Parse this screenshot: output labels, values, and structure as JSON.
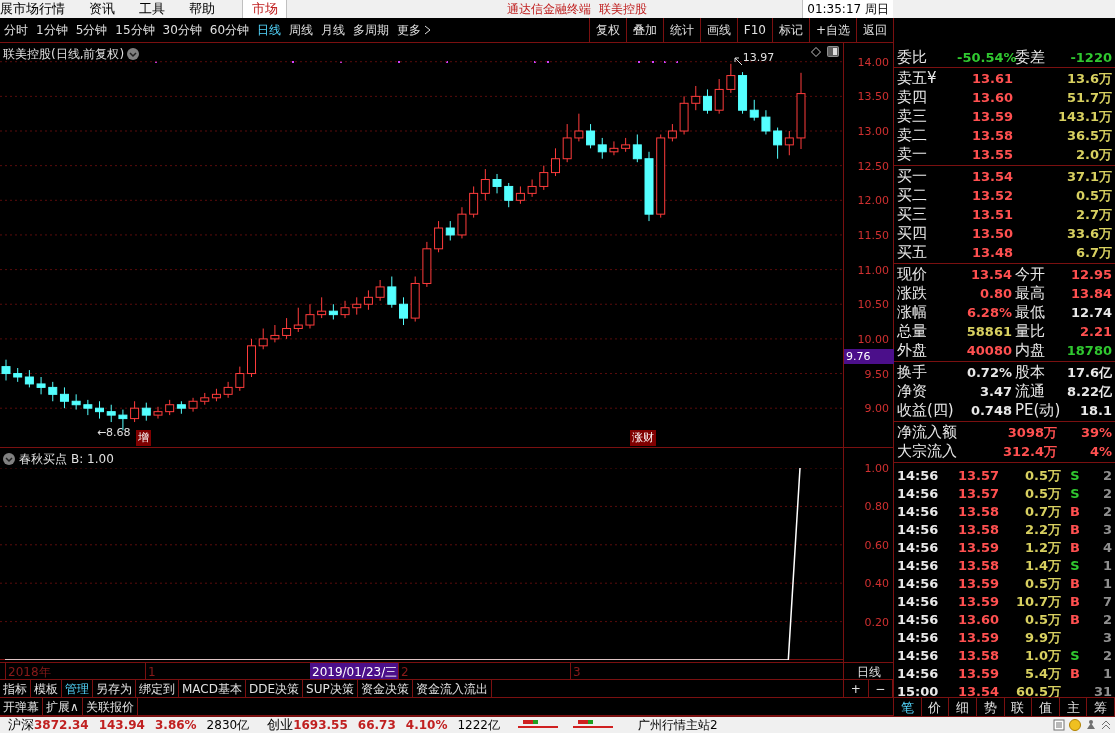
{
  "menu_bar": {
    "items": [
      "展市场行情",
      "资讯",
      "工具",
      "帮助"
    ],
    "market_tab": "市场",
    "app_title": "通达信金融终端",
    "stock_title": "联美控股",
    "clock": "01:35:17 周日"
  },
  "toolbar": {
    "periods": [
      {
        "label": "分时",
        "selected": false
      },
      {
        "label": "1分钟",
        "selected": false
      },
      {
        "label": "5分钟",
        "selected": false
      },
      {
        "label": "15分钟",
        "selected": false
      },
      {
        "label": "30分钟",
        "selected": false
      },
      {
        "label": "60分钟",
        "selected": false
      },
      {
        "label": "日线",
        "selected": true
      },
      {
        "label": "周线",
        "selected": false
      },
      {
        "label": "月线",
        "selected": false
      },
      {
        "label": "多周期",
        "selected": false
      },
      {
        "label": "更多",
        "selected": false
      }
    ],
    "actions": [
      "复权",
      "叠加",
      "统计",
      "画线",
      "F10",
      "标记",
      "+自选",
      "返回"
    ]
  },
  "main_chart": {
    "title": "联美控股(日线,前复权)",
    "cursor_price": "9.76",
    "high_label": "13.97",
    "low_label": "←8.68",
    "event_tags": [
      "增",
      "涨财"
    ],
    "chart_data": {
      "type": "candlestick",
      "grid": true,
      "ylim": [
        8.44,
        14.27
      ],
      "yticks": [
        {
          "value": 14,
          "label": "14.00"
        },
        {
          "value": 13.5,
          "label": "13.50"
        },
        {
          "value": 13,
          "label": "13.00"
        },
        {
          "value": 12.5,
          "label": "12.50"
        },
        {
          "value": 12,
          "label": "12.00"
        },
        {
          "value": 11.5,
          "label": "11.50"
        },
        {
          "value": 11,
          "label": "11.00"
        },
        {
          "value": 10.5,
          "label": "10.50"
        },
        {
          "value": 10,
          "label": "10.00"
        },
        {
          "value": 9.5,
          "label": "9.50"
        },
        {
          "value": 9,
          "label": "9.00"
        }
      ],
      "ohlc": [
        [
          9.6,
          9.7,
          9.4,
          9.5
        ],
        [
          9.5,
          9.58,
          9.38,
          9.45
        ],
        [
          9.45,
          9.55,
          9.3,
          9.35
        ],
        [
          9.35,
          9.45,
          9.2,
          9.3
        ],
        [
          9.3,
          9.38,
          9.1,
          9.2
        ],
        [
          9.2,
          9.3,
          9.0,
          9.1
        ],
        [
          9.1,
          9.2,
          8.98,
          9.05
        ],
        [
          9.05,
          9.12,
          8.9,
          9.0
        ],
        [
          9.0,
          9.1,
          8.85,
          8.95
        ],
        [
          8.95,
          9.05,
          8.8,
          8.9
        ],
        [
          8.9,
          8.98,
          8.68,
          8.85
        ],
        [
          8.85,
          9.1,
          8.8,
          9.0
        ],
        [
          9.0,
          9.08,
          8.82,
          8.9
        ],
        [
          8.9,
          9.02,
          8.85,
          8.95
        ],
        [
          8.95,
          9.12,
          8.9,
          9.05
        ],
        [
          9.05,
          9.1,
          8.92,
          9.0
        ],
        [
          9.0,
          9.15,
          8.95,
          9.1
        ],
        [
          9.1,
          9.22,
          9.05,
          9.15
        ],
        [
          9.15,
          9.28,
          9.1,
          9.2
        ],
        [
          9.2,
          9.38,
          9.15,
          9.3
        ],
        [
          9.3,
          9.6,
          9.25,
          9.5
        ],
        [
          9.5,
          10.0,
          9.45,
          9.9
        ],
        [
          9.9,
          10.15,
          9.85,
          10.0
        ],
        [
          10.0,
          10.2,
          9.95,
          10.05
        ],
        [
          10.05,
          10.3,
          10.0,
          10.15
        ],
        [
          10.15,
          10.45,
          10.1,
          10.2
        ],
        [
          10.2,
          10.5,
          10.15,
          10.35
        ],
        [
          10.35,
          10.6,
          10.3,
          10.4
        ],
        [
          10.4,
          10.5,
          10.28,
          10.35
        ],
        [
          10.35,
          10.55,
          10.3,
          10.45
        ],
        [
          10.45,
          10.6,
          10.35,
          10.5
        ],
        [
          10.5,
          10.7,
          10.42,
          10.6
        ],
        [
          10.6,
          10.85,
          10.55,
          10.75
        ],
        [
          10.75,
          10.9,
          10.45,
          10.5
        ],
        [
          10.5,
          10.6,
          10.2,
          10.3
        ],
        [
          10.3,
          10.9,
          10.25,
          10.8
        ],
        [
          10.8,
          11.4,
          10.75,
          11.3
        ],
        [
          11.3,
          11.7,
          11.25,
          11.6
        ],
        [
          11.6,
          11.7,
          11.42,
          11.5
        ],
        [
          11.5,
          11.9,
          11.45,
          11.8
        ],
        [
          11.8,
          12.2,
          11.75,
          12.1
        ],
        [
          12.1,
          12.45,
          12.0,
          12.3
        ],
        [
          12.3,
          12.38,
          12.1,
          12.2
        ],
        [
          12.2,
          12.25,
          11.9,
          12.0
        ],
        [
          12.0,
          12.2,
          11.95,
          12.1
        ],
        [
          12.1,
          12.3,
          12.05,
          12.2
        ],
        [
          12.2,
          12.5,
          12.15,
          12.4
        ],
        [
          12.4,
          12.75,
          12.35,
          12.6
        ],
        [
          12.6,
          13.1,
          12.55,
          12.9
        ],
        [
          12.9,
          13.25,
          12.85,
          13.0
        ],
        [
          13.0,
          13.1,
          12.75,
          12.8
        ],
        [
          12.8,
          12.9,
          12.6,
          12.7
        ],
        [
          12.7,
          12.85,
          12.65,
          12.75
        ],
        [
          12.75,
          12.9,
          12.7,
          12.8
        ],
        [
          12.8,
          12.95,
          12.55,
          12.6
        ],
        [
          12.6,
          12.7,
          11.7,
          11.8
        ],
        [
          11.8,
          12.95,
          11.75,
          12.9
        ],
        [
          12.9,
          13.1,
          12.85,
          13.0
        ],
        [
          13.0,
          13.5,
          12.95,
          13.4
        ],
        [
          13.4,
          13.65,
          13.3,
          13.5
        ],
        [
          13.5,
          13.6,
          13.25,
          13.3
        ],
        [
          13.3,
          13.75,
          13.25,
          13.6
        ],
        [
          13.6,
          13.97,
          13.55,
          13.8
        ],
        [
          13.8,
          13.85,
          13.25,
          13.3
        ],
        [
          13.3,
          13.45,
          13.15,
          13.2
        ],
        [
          13.2,
          13.3,
          12.95,
          13.0
        ],
        [
          13.0,
          13.05,
          12.6,
          12.8
        ],
        [
          12.8,
          13.0,
          12.65,
          12.9
        ],
        [
          12.9,
          13.84,
          12.74,
          13.54
        ]
      ]
    }
  },
  "indicator": {
    "title": "春秋买点",
    "reading": "B: 1.00",
    "chart_data": {
      "type": "line",
      "grid": true,
      "ylim": [
        0,
        1
      ],
      "yticks": [
        {
          "value": 0.2,
          "label": "0.20"
        },
        {
          "value": 0.4,
          "label": "0.40"
        },
        {
          "value": 0.6,
          "label": "0.60"
        },
        {
          "value": 0.8,
          "label": "0.80"
        },
        {
          "value": 1.0,
          "label": "1.00"
        }
      ],
      "series": [
        {
          "color": "#ffffff",
          "values": [
            0,
            0,
            0,
            0,
            0,
            0,
            0,
            0,
            0,
            0,
            0,
            0,
            0,
            0,
            0,
            0,
            0,
            0,
            0,
            0,
            0,
            0,
            0,
            0,
            0,
            0,
            0,
            0,
            0,
            0,
            0,
            0,
            0,
            0,
            0,
            0,
            0,
            0,
            0,
            0,
            0,
            0,
            0,
            0,
            0,
            0,
            0,
            0,
            0,
            0,
            0,
            0,
            0,
            0,
            0,
            0,
            0,
            0,
            0,
            0,
            0,
            0,
            0,
            0,
            0,
            0,
            0,
            0,
            1
          ]
        }
      ]
    }
  },
  "date_axis": {
    "labels": [
      {
        "text": "2018年",
        "selected": false
      },
      {
        "text": "1",
        "selected": false
      },
      {
        "text": "2019/01/23/三",
        "selected": true
      },
      {
        "text": "2",
        "selected": false
      },
      {
        "text": "3",
        "selected": false
      }
    ],
    "period": "日线"
  },
  "tabs": [
    {
      "label": "指标",
      "selected": false
    },
    {
      "label": "模板",
      "selected": false
    },
    {
      "label": "管理",
      "selected": true
    },
    {
      "label": "另存为",
      "selected": false
    },
    {
      "label": "绑定到",
      "selected": false
    },
    {
      "label": "MACD基本",
      "selected": false
    },
    {
      "label": "DDE决策",
      "selected": false
    },
    {
      "label": "SUP决策",
      "selected": false
    },
    {
      "label": "资金决策",
      "selected": false
    },
    {
      "label": "资金流入流出",
      "selected": false
    }
  ],
  "zoom_buttons": [
    "+",
    "−"
  ],
  "tabs_row2": [
    "开弹幕",
    "扩展∧",
    "关联报价"
  ],
  "quote_panel": {
    "ratio": [
      {
        "label": "委比",
        "value": "-50.54%",
        "color": "#30c830"
      },
      {
        "label": "委差",
        "value": "-1220",
        "color": "#30c830"
      }
    ],
    "asks": [
      {
        "label": "卖五¥",
        "price": "13.61",
        "volume": "13.6万"
      },
      {
        "label": "卖四",
        "price": "13.60",
        "volume": "51.7万"
      },
      {
        "label": "卖三",
        "price": "13.59",
        "volume": "143.1万"
      },
      {
        "label": "卖二",
        "price": "13.58",
        "volume": "36.5万"
      },
      {
        "label": "卖一",
        "price": "13.55",
        "volume": "2.0万"
      }
    ],
    "bids": [
      {
        "label": "买一",
        "price": "13.54",
        "volume": "37.1万"
      },
      {
        "label": "买二",
        "price": "13.52",
        "volume": "0.5万"
      },
      {
        "label": "买三",
        "price": "13.51",
        "volume": "2.7万"
      },
      {
        "label": "买四",
        "price": "13.50",
        "volume": "33.6万"
      },
      {
        "label": "买五",
        "price": "13.48",
        "volume": "6.7万"
      }
    ],
    "stats": [
      {
        "label": "现价",
        "value": "13.54",
        "color": "#ff5050"
      },
      {
        "label": "今开",
        "value": "12.95",
        "color": "#ff5050"
      },
      {
        "label": "涨跌",
        "value": "0.80",
        "color": "#ff5050"
      },
      {
        "label": "最高",
        "value": "13.84",
        "color": "#ff5050"
      },
      {
        "label": "涨幅",
        "value": "6.28%",
        "color": "#ff5050"
      },
      {
        "label": "最低",
        "value": "12.74",
        "color": "#e8e8e8"
      },
      {
        "label": "总量",
        "value": "58861",
        "color": "#d8d060"
      },
      {
        "label": "量比",
        "value": "2.21",
        "color": "#ff5050"
      },
      {
        "label": "外盘",
        "value": "40080",
        "color": "#ff5050"
      },
      {
        "label": "内盘",
        "value": "18780",
        "color": "#30c830"
      }
    ],
    "stats2": [
      {
        "label": "换手",
        "value": "0.72%"
      },
      {
        "label": "股本",
        "value": "17.6亿"
      },
      {
        "label": "净资",
        "value": "3.47"
      },
      {
        "label": "流通",
        "value": "8.22亿"
      },
      {
        "label": "收益(四)",
        "value": "0.748"
      },
      {
        "label": "PE(动)",
        "value": "18.1"
      }
    ],
    "flows": [
      {
        "label": "净流入额",
        "value": "3098万",
        "pct": "39%"
      },
      {
        "label": "大宗流入",
        "value": "312.4万",
        "pct": "4%"
      }
    ],
    "ticks": [
      {
        "time": "14:56",
        "price": "13.57",
        "volume": "0.5万",
        "side": "S",
        "color": "#30c830",
        "count": "2"
      },
      {
        "time": "14:56",
        "price": "13.57",
        "volume": "0.5万",
        "side": "S",
        "color": "#30c830",
        "count": "2"
      },
      {
        "time": "14:56",
        "price": "13.58",
        "volume": "0.7万",
        "side": "B",
        "color": "#ff5050",
        "count": "2"
      },
      {
        "time": "14:56",
        "price": "13.58",
        "volume": "2.2万",
        "side": "B",
        "color": "#ff5050",
        "count": "3"
      },
      {
        "time": "14:56",
        "price": "13.59",
        "volume": "1.2万",
        "side": "B",
        "color": "#ff5050",
        "count": "4"
      },
      {
        "time": "14:56",
        "price": "13.58",
        "volume": "1.4万",
        "side": "S",
        "color": "#30c830",
        "count": "1"
      },
      {
        "time": "14:56",
        "price": "13.59",
        "volume": "0.5万",
        "side": "B",
        "color": "#ff5050",
        "count": "1"
      },
      {
        "time": "14:56",
        "price": "13.59",
        "volume": "10.7万",
        "side": "B",
        "color": "#ff5050",
        "count": "7"
      },
      {
        "time": "14:56",
        "price": "13.60",
        "volume": "0.5万",
        "side": "B",
        "color": "#ff5050",
        "count": "2"
      },
      {
        "time": "14:56",
        "price": "13.59",
        "volume": "9.9万",
        "count": "3"
      },
      {
        "time": "14:56",
        "price": "13.58",
        "volume": "1.0万",
        "side": "S",
        "color": "#30c830",
        "count": "2"
      },
      {
        "time": "14:56",
        "price": "13.59",
        "volume": "5.4万",
        "side": "B",
        "color": "#ff5050",
        "count": "1"
      },
      {
        "time": "15:00",
        "price": "13.54",
        "volume": "60.5万",
        "count": "31"
      }
    ],
    "tabs": [
      {
        "label": "笔",
        "selected": true
      },
      {
        "label": "价",
        "selected": false
      },
      {
        "label": "细",
        "selected": false
      },
      {
        "label": "势",
        "selected": false
      },
      {
        "label": "联",
        "selected": false
      },
      {
        "label": "值",
        "selected": false
      },
      {
        "label": "主",
        "selected": false
      },
      {
        "label": "筹",
        "selected": false
      }
    ]
  },
  "status_bar": {
    "indices": [
      {
        "name": "沪深",
        "value": "3872.34",
        "change": "143.94",
        "pct": "3.86%",
        "amount": "2830亿"
      },
      {
        "name": "创业",
        "value": "1693.55",
        "change": "66.73",
        "pct": "4.10%",
        "amount": "1222亿"
      }
    ],
    "server": "广州行情主站2"
  }
}
